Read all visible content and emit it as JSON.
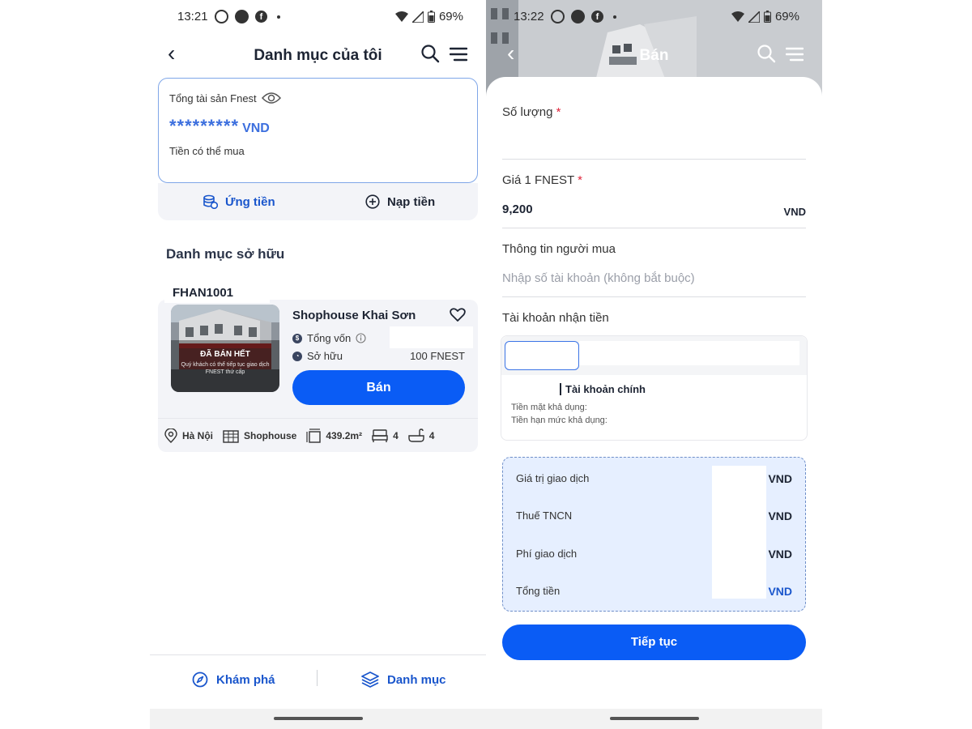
{
  "left_screen": {
    "status_bar": {
      "time": "13:21",
      "battery": "69%"
    },
    "header": {
      "back": "‹",
      "title": "Danh mục của tôi"
    },
    "balance": {
      "label": "Tổng tài sản Fnest",
      "masked_value": "*********",
      "currency": "VND",
      "available_label": "Tiền có thể mua"
    },
    "actions": {
      "advance": "Ứng tiền",
      "deposit": "Nạp tiền"
    },
    "section_title": "Danh mục sở hữu",
    "asset": {
      "code": "FHAN1001",
      "name": "Shophouse Khai Sơn",
      "sold_out": "ĐÃ BÁN HẾT",
      "sold_out_note": "Quý khách có thể tiếp tục giao dịch FNEST thứ cấp",
      "capital_label": "Tổng vốn",
      "owned_label": "Sở hữu",
      "owned_value": "100  FNEST",
      "sell_button": "Bán",
      "location": "Hà Nội",
      "type": "Shophouse",
      "area": "439.2m²",
      "bedrooms": "4",
      "bathrooms": "4"
    },
    "bottom_nav": {
      "explore": "Khám phá",
      "portfolio": "Danh mục"
    }
  },
  "right_screen": {
    "status_bar": {
      "time": "13:22",
      "battery": "69%"
    },
    "header": {
      "back": "‹",
      "title": "Bán"
    },
    "form": {
      "quantity_label": "Số lượng",
      "required_mark": "*",
      "price_label": "Giá 1 FNEST",
      "price_value": "9,200",
      "price_unit": "VND",
      "buyer_label": "Thông tin người mua",
      "buyer_placeholder": "Nhập số tài khoản (không bắt buộc)",
      "receive_label": "Tài khoản nhận tiền"
    },
    "account": {
      "main_label": "Tài khoản chính",
      "cash_label": "Tiền mặt khả dụng:",
      "credit_label": "Tiền hạn mức khả dụng:"
    },
    "summary": {
      "rows": [
        {
          "label": "Giá trị giao dịch",
          "unit": "VND"
        },
        {
          "label": "Thuế TNCN",
          "unit": "VND"
        },
        {
          "label": "Phí giao dịch",
          "unit": "VND"
        },
        {
          "label": "Tổng tiền",
          "unit": "VND"
        }
      ]
    },
    "continue_button": "Tiếp tục"
  },
  "colors": {
    "primary": "#0a5cf5",
    "link_blue": "#1a56cc",
    "summary_bg": "#e6efff",
    "required": "#e0243b"
  }
}
